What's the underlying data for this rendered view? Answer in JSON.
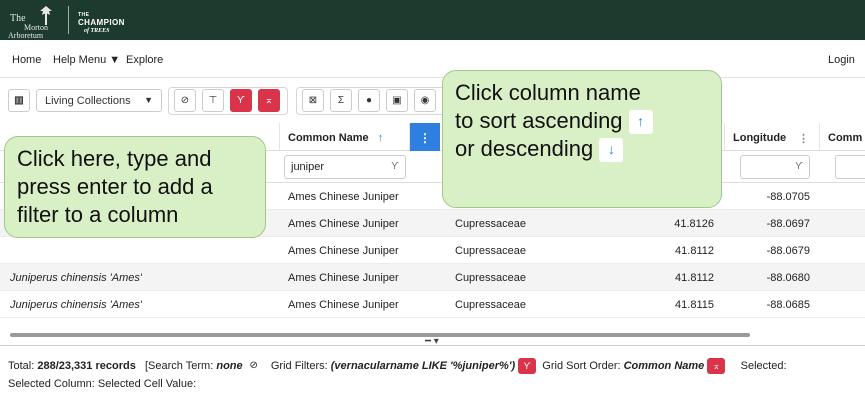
{
  "header": {
    "logo_left": [
      "The",
      "Morton",
      "Arboretum"
    ],
    "logo_right": [
      "THE",
      "CHAMPION",
      "of TREES"
    ],
    "bg_color": "#1d3a2f"
  },
  "nav": {
    "home": "Home",
    "help_menu": "Help Menu",
    "explore": "Explore",
    "login": "Login"
  },
  "toolbar": {
    "columns_icon": "columns-icon",
    "collection_select": "Living Collections",
    "buttons": [
      {
        "icon": "clear-search-icon",
        "glyph": "⊘"
      },
      {
        "icon": "filter-icon",
        "glyph": "⊤"
      },
      {
        "icon": "clear-filter-icon",
        "glyph": "Ƴ"
      },
      {
        "icon": "clear-sort-icon",
        "glyph": "⌅"
      },
      {
        "icon": "export-icon",
        "glyph": "⊠"
      },
      {
        "icon": "sum-icon",
        "glyph": "Σ"
      },
      {
        "icon": "view-icon",
        "glyph": "●"
      },
      {
        "icon": "image-icon",
        "glyph": "▣"
      },
      {
        "icon": "map-icon",
        "glyph": "◉"
      }
    ],
    "accent_red": "#d9344a"
  },
  "grid": {
    "headers": {
      "common_name": "Common Name",
      "sort_arrow": "↑",
      "longitude": "Longitude",
      "comm": "Comm"
    },
    "filter_value": "juniper",
    "rows": [
      {
        "name": "",
        "common": "Ames Chinese Juniper",
        "family": "",
        "lat": "",
        "lon": "-88.0705"
      },
      {
        "name": "",
        "common": "Ames Chinese Juniper",
        "family": "Cupressaceae",
        "lat": "41.8126",
        "lon": "-88.0697"
      },
      {
        "name": "",
        "common": "Ames Chinese Juniper",
        "family": "Cupressaceae",
        "lat": "41.8112",
        "lon": "-88.0679"
      },
      {
        "name": "Juniperus chinensis 'Ames'",
        "common": "Ames Chinese Juniper",
        "family": "Cupressaceae",
        "lat": "41.8112",
        "lon": "-88.0680"
      },
      {
        "name": "Juniperus chinensis 'Ames'",
        "common": "Ames Chinese Juniper",
        "family": "Cupressaceae",
        "lat": "41.8115",
        "lon": "-88.0685"
      }
    ]
  },
  "callouts": {
    "left": "Click here, type and press enter to add a filter to a column",
    "right_l1": "Click column name",
    "right_l2": "to sort ascending",
    "right_l3": "or descending",
    "up": "↑",
    "down": "↓"
  },
  "status": {
    "total_label": "Total:",
    "total_value": "288/23,331 records",
    "search_label": "[Search Term:",
    "search_value": "none",
    "grid_filters_label": "Grid Filters:",
    "grid_filters_value": "(vernacularname LIKE '%juniper%')",
    "sort_label": "Grid Sort Order:",
    "sort_value": "Common Name",
    "selected": "Selected:",
    "selected_column": "Selected Column:",
    "selected_cell": "Selected Cell Value:"
  }
}
